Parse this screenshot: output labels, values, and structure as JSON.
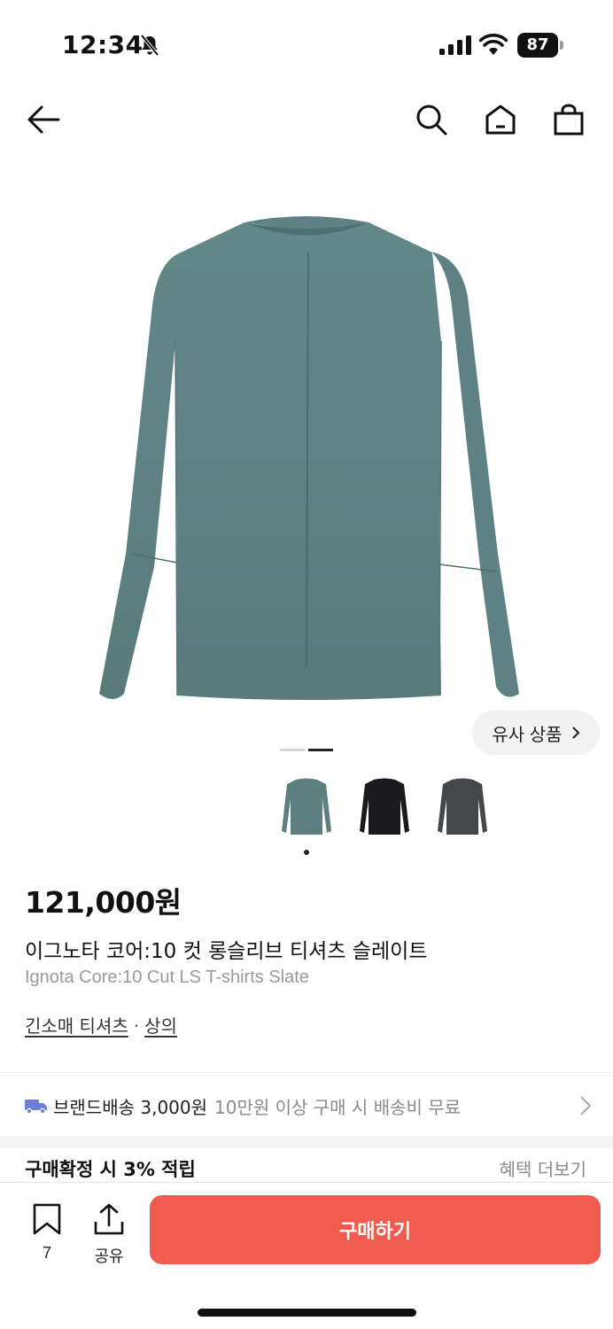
{
  "status_bar": {
    "time": "12:34",
    "battery": "87"
  },
  "nav": {
    "icons": [
      "back-arrow-icon",
      "search-icon",
      "home-icon",
      "shopping-bag-icon"
    ]
  },
  "gallery": {
    "similar_label": "유사 상품",
    "page_count": 2,
    "active_page": 2,
    "thumbnails": [
      {
        "color": "#5e7f7f",
        "name": "slate"
      },
      {
        "color": "#1a1a1c",
        "name": "black"
      },
      {
        "color": "#45484a",
        "name": "charcoal"
      }
    ],
    "selected_thumbnail": 0
  },
  "product": {
    "price": "121,000원",
    "name_ko": "이그노타 코어:10 컷 롱슬리브 티셔츠 슬레이트",
    "name_en": "Ignota Core:10 Cut LS T-shirts Slate",
    "category_1": "긴소매 티셔츠",
    "category_sep": "·",
    "category_2": "상의"
  },
  "shipping": {
    "main": "브랜드배송 3,000원",
    "sub": "10만원 이상 구매 시 배송비 무료"
  },
  "reward": {
    "title": "구매확정 시 3% 적립",
    "more": "혜택 더보기"
  },
  "bottom_bar": {
    "bookmark_count": "7",
    "share_label": "공유",
    "buy_label": "구매하기"
  },
  "colors": {
    "accent": "#ef5c4f",
    "product": "#5e7f7f"
  }
}
